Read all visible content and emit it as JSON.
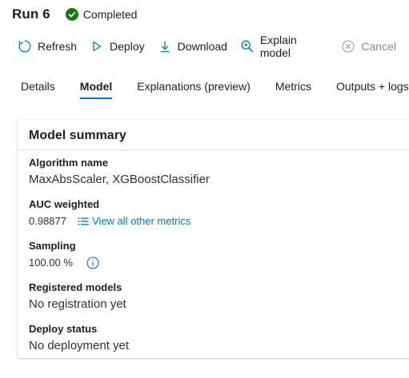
{
  "header": {
    "run_title": "Run 6",
    "status": "Completed",
    "status_color": "#107c10"
  },
  "toolbar": {
    "items": [
      {
        "label": "Refresh",
        "icon": "refresh-icon",
        "enabled": true
      },
      {
        "label": "Deploy",
        "icon": "deploy-icon",
        "enabled": true
      },
      {
        "label": "Download",
        "icon": "download-icon",
        "enabled": true
      },
      {
        "label": "Explain model",
        "icon": "explain-model-icon",
        "enabled": true
      },
      {
        "label": "Cancel",
        "icon": "cancel-icon",
        "enabled": false
      }
    ]
  },
  "tabs": [
    {
      "label": "Details",
      "active": false
    },
    {
      "label": "Model",
      "active": true
    },
    {
      "label": "Explanations (preview)",
      "active": false
    },
    {
      "label": "Metrics",
      "active": false
    },
    {
      "label": "Outputs + logs",
      "active": false
    }
  ],
  "model_summary": {
    "title": "Model summary",
    "algorithm": {
      "label": "Algorithm name",
      "value": "MaxAbsScaler, XGBoostClassifier"
    },
    "auc": {
      "label": "AUC weighted",
      "value": "0.98877",
      "link_label": "View all other metrics"
    },
    "sampling": {
      "label": "Sampling",
      "value": "100.00 %"
    },
    "registered": {
      "label": "Registered models",
      "value": "No registration yet"
    },
    "deploy_status": {
      "label": "Deploy status",
      "value": "No deployment yet"
    }
  },
  "accent_color": "#0078d4"
}
